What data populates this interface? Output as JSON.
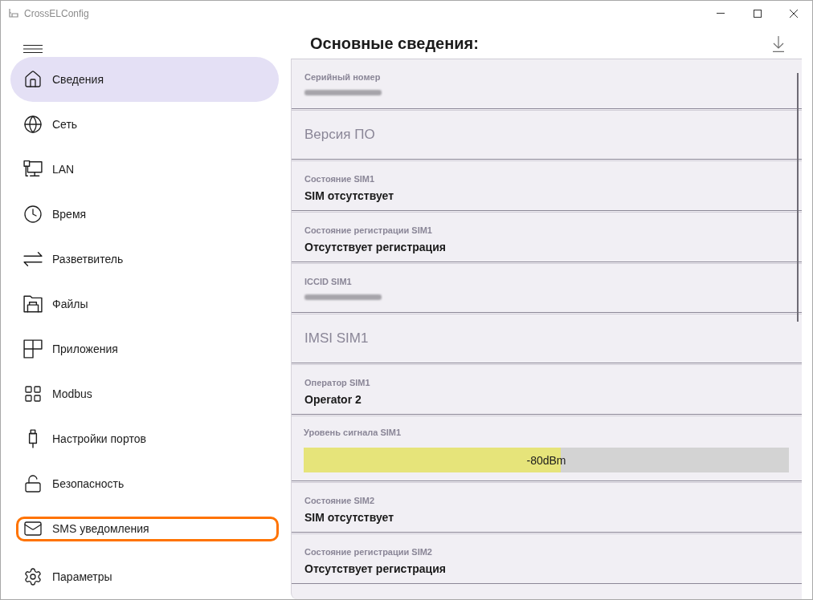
{
  "window": {
    "title": "CrossELConfig"
  },
  "nav": {
    "items": [
      {
        "label": "Сведения",
        "selected": true,
        "highlighted": false
      },
      {
        "label": "Сеть",
        "selected": false,
        "highlighted": false
      },
      {
        "label": "LAN",
        "selected": false,
        "highlighted": false
      },
      {
        "label": "Время",
        "selected": false,
        "highlighted": false
      },
      {
        "label": "Разветвитель",
        "selected": false,
        "highlighted": false
      },
      {
        "label": "Файлы",
        "selected": false,
        "highlighted": false
      },
      {
        "label": "Приложения",
        "selected": false,
        "highlighted": false
      },
      {
        "label": "Modbus",
        "selected": false,
        "highlighted": false
      },
      {
        "label": "Настройки портов",
        "selected": false,
        "highlighted": false
      },
      {
        "label": "Безопасность",
        "selected": false,
        "highlighted": false
      },
      {
        "label": "SMS уведомления",
        "selected": false,
        "highlighted": true
      }
    ],
    "footer": [
      {
        "label": "Параметры",
        "selected": false,
        "highlighted": false
      }
    ]
  },
  "content": {
    "title": "Основные сведения:",
    "rows": [
      {
        "kind": "redacted",
        "label": "Серийный номер"
      },
      {
        "kind": "empty",
        "label": "Версия ПО"
      },
      {
        "kind": "value",
        "label": "Состояние SIM1",
        "value": "SIM отсутствует"
      },
      {
        "kind": "value",
        "label": "Состояние регистрации SIM1",
        "value": "Отсутствует регистрация"
      },
      {
        "kind": "redacted",
        "label": "ICCID SIM1"
      },
      {
        "kind": "empty",
        "label": "IMSI SIM1"
      },
      {
        "kind": "value",
        "label": "Оператор SIM1",
        "value": "Operator 2"
      },
      {
        "kind": "meter",
        "label": "Уровень сигнала SIM1",
        "level": 0.53,
        "reading": "-80dBm"
      },
      {
        "kind": "value",
        "label": "Состояние SIM2",
        "value": "SIM отсутствует"
      },
      {
        "kind": "value",
        "label": "Состояние регистрации SIM2",
        "value": "Отсутствует регистрация"
      }
    ]
  }
}
